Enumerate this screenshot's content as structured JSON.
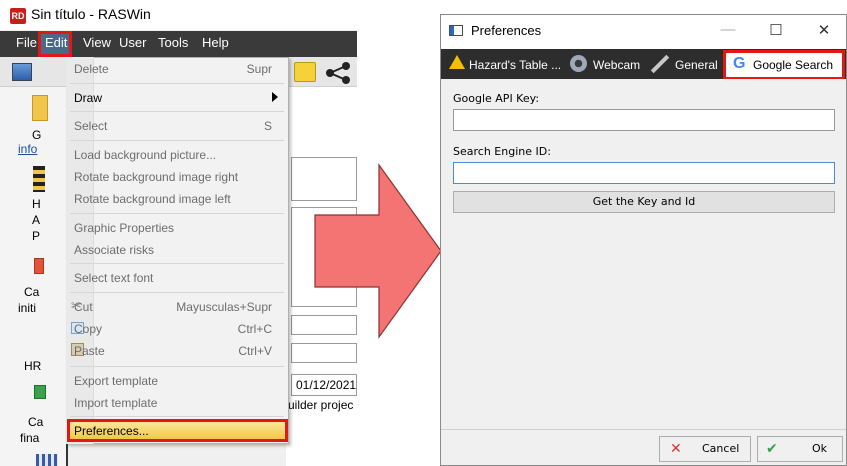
{
  "left_window": {
    "title": "Sin título - RASWin",
    "logo_text": "RD",
    "menubar": [
      "File",
      "Edit",
      "View",
      "User",
      "Tools",
      "Help"
    ],
    "sidebar": {
      "labels": [
        "G",
        "info",
        "H",
        "A",
        "P",
        "Ca",
        "initi",
        "HR",
        "Ca",
        "fina"
      ]
    },
    "right_content": {
      "date_value": "01/12/2021",
      "project_text": "uilder projec"
    }
  },
  "edit_menu": {
    "items": [
      {
        "label": "Delete",
        "shortcut": "Supr",
        "enabled": false
      },
      {
        "label": "Draw",
        "shortcut": "",
        "enabled": true,
        "submenu": true
      },
      {
        "label": "Select",
        "shortcut": "S",
        "enabled": false
      },
      {
        "label": "Load background picture...",
        "shortcut": "",
        "enabled": false
      },
      {
        "label": "Rotate background image right",
        "shortcut": "",
        "enabled": false
      },
      {
        "label": "Rotate background image left",
        "shortcut": "",
        "enabled": false
      },
      {
        "label": "Graphic Properties",
        "shortcut": "",
        "enabled": false
      },
      {
        "label": "Associate risks",
        "shortcut": "",
        "enabled": false
      },
      {
        "label": "Select text font",
        "shortcut": "",
        "enabled": false
      },
      {
        "label": "Cut",
        "shortcut": "Mayusculas+Supr",
        "enabled": false
      },
      {
        "label": "Copy",
        "shortcut": "Ctrl+C",
        "enabled": false
      },
      {
        "label": "Paste",
        "shortcut": "Ctrl+V",
        "enabled": false
      },
      {
        "label": "Export template",
        "shortcut": "",
        "enabled": false
      },
      {
        "label": "Import template",
        "shortcut": "",
        "enabled": false
      },
      {
        "label": "Preferences...",
        "shortcut": "",
        "enabled": true,
        "highlighted": true
      }
    ]
  },
  "dialog": {
    "title": "Preferences",
    "tabs": [
      {
        "label": "Hazard's Table ...",
        "icon": "warning-icon"
      },
      {
        "label": "Webcam",
        "icon": "webcam-icon"
      },
      {
        "label": "General",
        "icon": "wrench-icon"
      },
      {
        "label": "Google Search",
        "icon": "google-icon",
        "active": true
      }
    ],
    "fields": {
      "api_key_label": "Google API Key:",
      "api_key_value": "",
      "engine_id_label": "Search Engine ID:",
      "engine_id_value": ""
    },
    "get_key_button": "Get the Key and Id",
    "cancel_button": "Cancel",
    "ok_button": "Ok"
  },
  "colors": {
    "highlight_red": "#e01818",
    "arrow_fill": "#f47474",
    "menubar_dark": "#3a3a3a",
    "tabbar_dark": "#2d2d2d",
    "preferences_highlight": "#f2c746"
  }
}
